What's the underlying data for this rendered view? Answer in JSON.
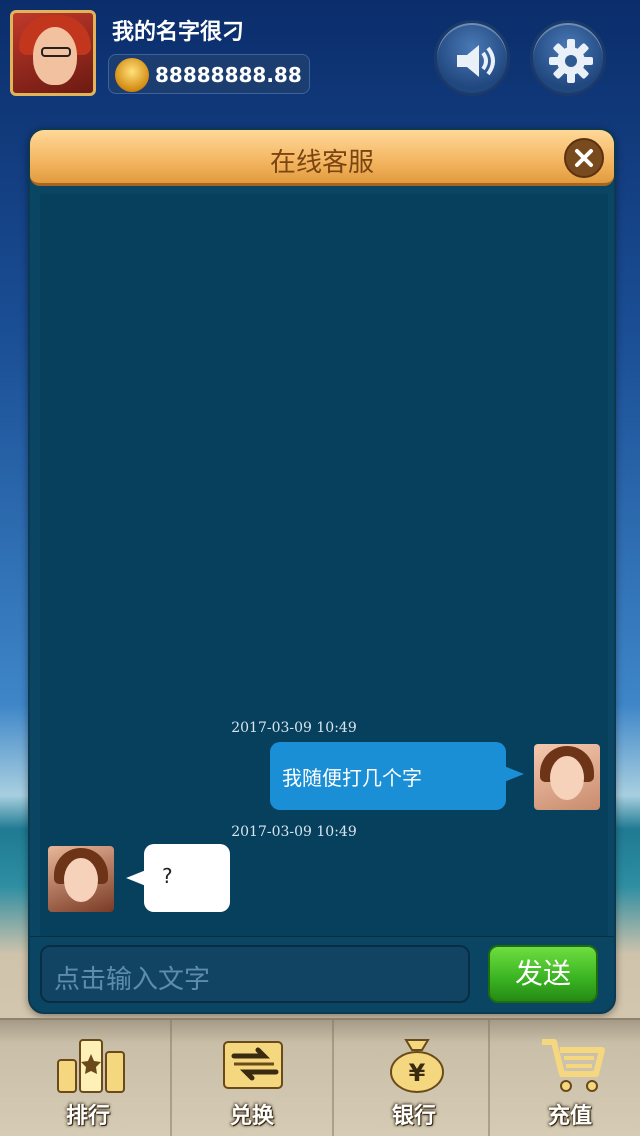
{
  "header": {
    "username": "我的名字很刁",
    "balance": "88888888.88",
    "avatar_icon": "player-avatar",
    "coin_icon": "coin-stack-icon"
  },
  "controls": {
    "sound_icon": "speaker-icon",
    "settings_icon": "gear-icon"
  },
  "chat": {
    "title": "在线客服",
    "close_icon": "close-icon",
    "messages": [
      {
        "timestamp": "2017-03-09 10:49",
        "side": "right",
        "text": "我随便打几个字"
      },
      {
        "timestamp": "2017-03-09 10:49",
        "side": "left",
        "text": "?"
      }
    ],
    "input_placeholder": "点击输入文字",
    "send_label": "发送"
  },
  "bottom_nav": {
    "items": [
      {
        "label": "排行",
        "icon": "ranking-icon"
      },
      {
        "label": "兑换",
        "icon": "exchange-icon"
      },
      {
        "label": "银行",
        "icon": "money-bag-icon"
      },
      {
        "label": "充值",
        "icon": "shopping-cart-icon"
      }
    ]
  },
  "colors": {
    "panel_bg": "#07405d",
    "header_orange": "#f3b560",
    "outgoing_bubble": "#1a8fd6",
    "send_green": "#39b222"
  }
}
